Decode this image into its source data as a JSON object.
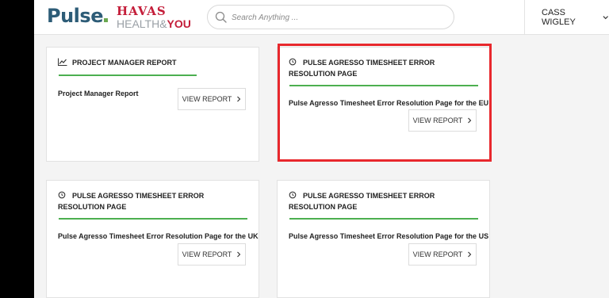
{
  "header": {
    "logo_pulse": "Pulse",
    "logo_havas_line1": "HAVAS",
    "logo_havas_health": "HEALTH",
    "logo_havas_amp": "&",
    "logo_havas_you": "YOU",
    "search_placeholder": "Search Anything ...",
    "user_name": "CASS WIGLEY"
  },
  "cards": [
    {
      "title": "PROJECT MANAGER REPORT",
      "icon": "line-chart-icon",
      "subtitle": "Project Manager Report",
      "button_label": "VIEW REPORT"
    },
    {
      "title": "PULSE AGRESSO TIMESHEET ERROR RESOLUTION PAGE",
      "icon": "clock-icon",
      "subtitle": "Pulse Agresso Timesheet Error Resolution Page for the EU",
      "button_label": "VIEW REPORT"
    },
    {
      "title": "PULSE AGRESSO TIMESHEET ERROR RESOLUTION PAGE",
      "icon": "clock-icon",
      "subtitle": "Pulse Agresso Timesheet Error Resolution Page for the UK",
      "button_label": "VIEW REPORT"
    },
    {
      "title": "PULSE AGRESSO TIMESHEET ERROR RESOLUTION PAGE",
      "icon": "clock-icon",
      "subtitle": "Pulse Agresso Timesheet Error Resolution Page for the US",
      "button_label": "VIEW REPORT"
    }
  ],
  "colors": {
    "accent_green": "#4caf50",
    "highlight_red": "#e8282d",
    "pulse_blue": "#2d5c77",
    "havas_red": "#c41e3a"
  }
}
